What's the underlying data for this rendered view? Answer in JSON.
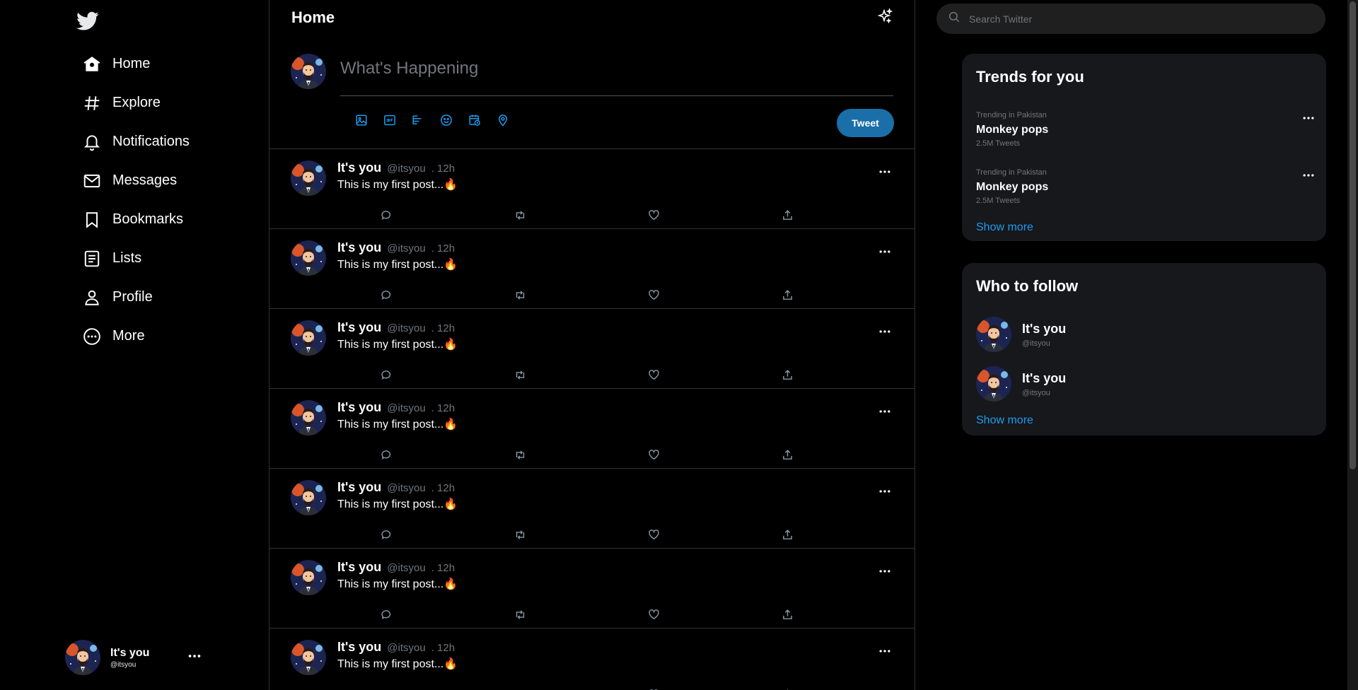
{
  "nav": {
    "items": [
      {
        "label": "Home",
        "icon": "home-icon"
      },
      {
        "label": "Explore",
        "icon": "hashtag-icon"
      },
      {
        "label": "Notifications",
        "icon": "bell-icon"
      },
      {
        "label": "Messages",
        "icon": "envelope-icon"
      },
      {
        "label": "Bookmarks",
        "icon": "bookmark-icon"
      },
      {
        "label": "Lists",
        "icon": "list-icon"
      },
      {
        "label": "Profile",
        "icon": "user-icon"
      },
      {
        "label": "More",
        "icon": "more-circle-icon"
      }
    ]
  },
  "account": {
    "name": "It's you",
    "handle": "@itsyou"
  },
  "main": {
    "title": "Home",
    "composer": {
      "placeholder": "What's Happening",
      "tweet_label": "Tweet"
    }
  },
  "posts": [
    {
      "name": "It's you",
      "handle": "@itsyou",
      "time": ". 12h",
      "text": "This is my first post...🔥"
    },
    {
      "name": "It's you",
      "handle": "@itsyou",
      "time": ". 12h",
      "text": "This is my first post...🔥"
    },
    {
      "name": "It's you",
      "handle": "@itsyou",
      "time": ". 12h",
      "text": "This is my first post...🔥"
    },
    {
      "name": "It's you",
      "handle": "@itsyou",
      "time": ". 12h",
      "text": "This is my first post...🔥"
    },
    {
      "name": "It's you",
      "handle": "@itsyou",
      "time": ". 12h",
      "text": "This is my first post...🔥"
    },
    {
      "name": "It's you",
      "handle": "@itsyou",
      "time": ". 12h",
      "text": "This is my first post...🔥"
    },
    {
      "name": "It's you",
      "handle": "@itsyou",
      "time": ". 12h",
      "text": "This is my first post...🔥"
    }
  ],
  "search": {
    "placeholder": "Search Twitter"
  },
  "trends": {
    "title": "Trends for you",
    "items": [
      {
        "context": "Trending in Pakistan",
        "topic": "Monkey pops",
        "count": "2.5M Tweets"
      },
      {
        "context": "Trending in Pakistan",
        "topic": "Monkey pops",
        "count": "2.5M Tweets"
      }
    ],
    "show_more": "Show more"
  },
  "follow": {
    "title": "Who to follow",
    "items": [
      {
        "name": "It's you",
        "handle": "@itsyou"
      },
      {
        "name": "It's you",
        "handle": "@itsyou"
      }
    ],
    "show_more": "Show more"
  },
  "colors": {
    "accent": "#1d9bf0",
    "tweet_button": "#1a6fa8",
    "background": "#000000",
    "panel": "#16181c"
  }
}
